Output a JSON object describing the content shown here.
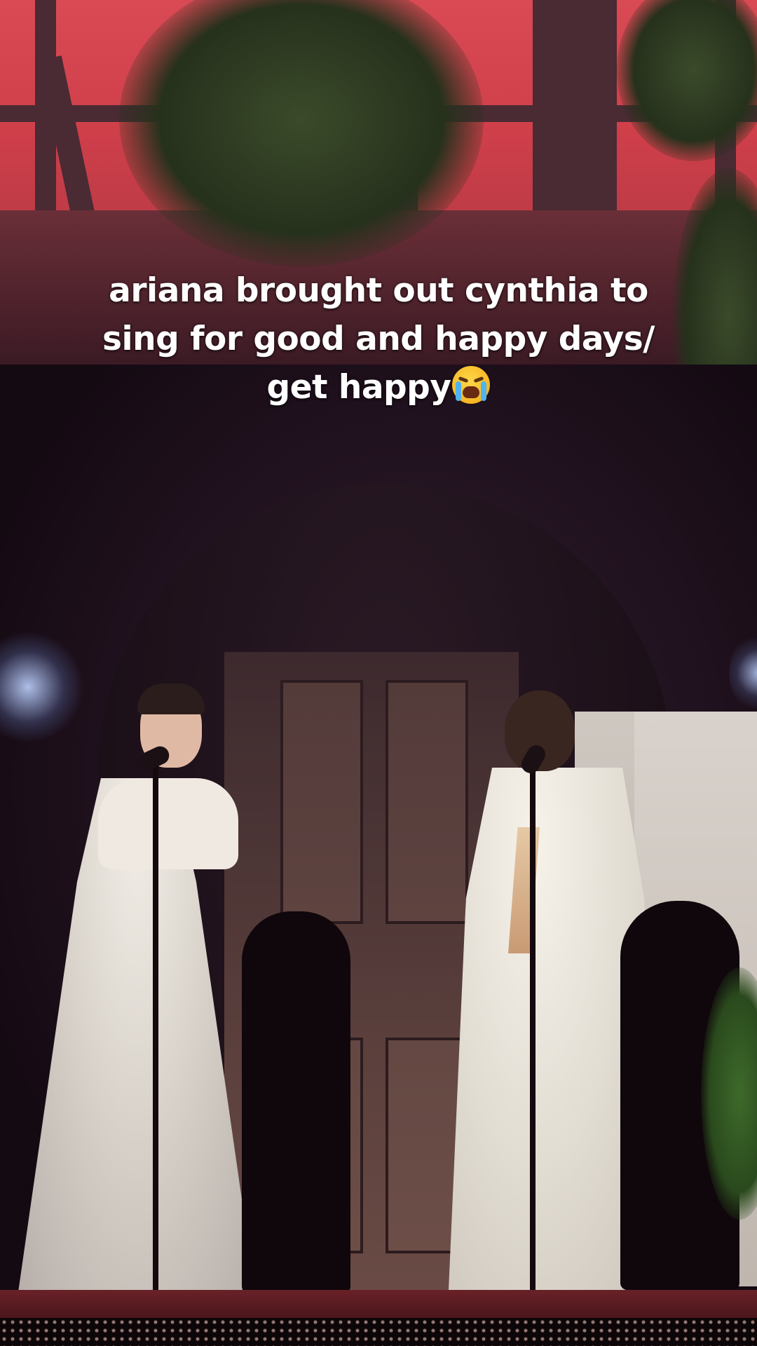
{
  "caption": {
    "line1": "ariana brought out cynthia to",
    "line2": "sing for good and happy days/",
    "line3": "get happy",
    "emoji": "loudly-crying-face-icon"
  },
  "colors": {
    "backdrop_red": "#d94a55",
    "stage_floor": "#6a2128",
    "caption_text": "#ffffff"
  }
}
